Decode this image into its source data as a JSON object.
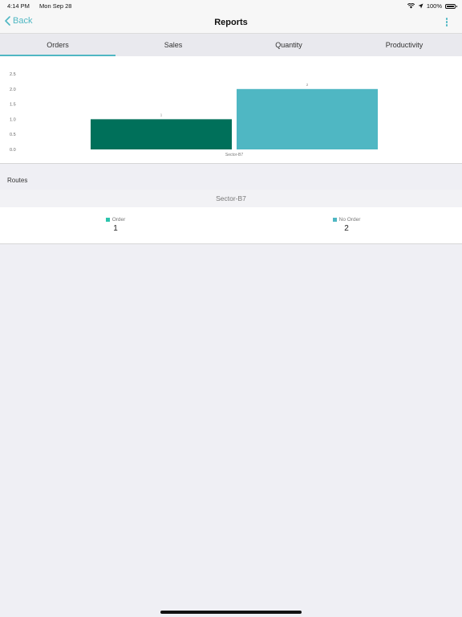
{
  "status_bar": {
    "time": "4:14 PM",
    "date": "Mon Sep 28",
    "battery": "100%"
  },
  "nav": {
    "back_label": "Back",
    "title": "Reports"
  },
  "tabs": [
    {
      "label": "Orders",
      "active": true
    },
    {
      "label": "Sales",
      "active": false
    },
    {
      "label": "Quantity",
      "active": false
    },
    {
      "label": "Productivity",
      "active": false
    }
  ],
  "chart_data": {
    "type": "bar",
    "categories": [
      "Sector-B7"
    ],
    "series": [
      {
        "name": "Order",
        "values": [
          1
        ],
        "color": "#00705a"
      },
      {
        "name": "No Order",
        "values": [
          2
        ],
        "color": "#4fb7c3"
      }
    ],
    "yticks": [
      "0.0",
      "0.5",
      "1.0",
      "1.5",
      "2.0",
      "2.5"
    ],
    "ylim": [
      0,
      2.5
    ],
    "data_labels": [
      "1",
      "2"
    ],
    "grid": false
  },
  "routes": {
    "header": "Routes",
    "sector": "Sector-B7",
    "legend": [
      {
        "label": "Order",
        "value": "1",
        "color": "#2cc4ad"
      },
      {
        "label": "No Order",
        "value": "2",
        "color": "#4fb7c3"
      }
    ]
  },
  "colors": {
    "accent": "#4fb7c3",
    "order_bar": "#00705a",
    "no_order_bar": "#4fb7c3"
  }
}
